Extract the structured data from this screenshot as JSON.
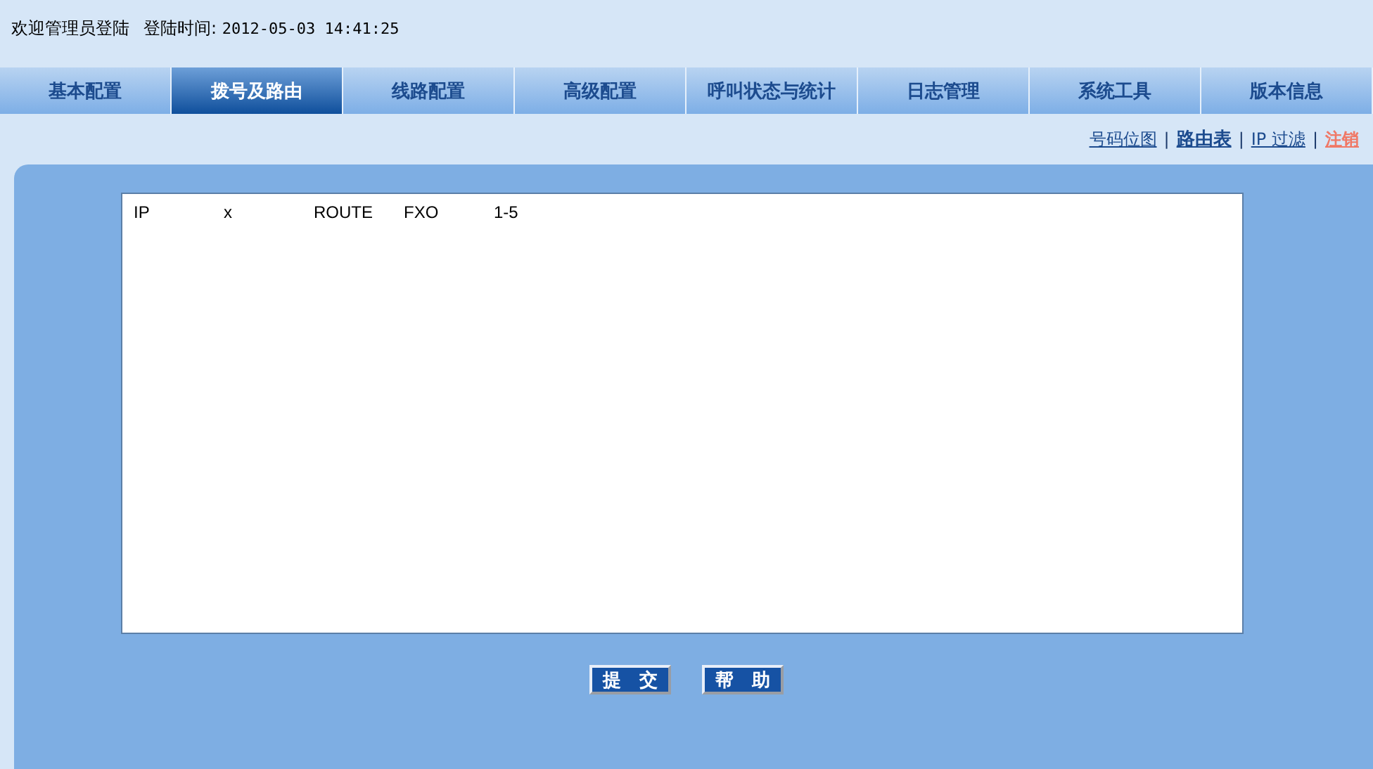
{
  "header": {
    "welcome": "欢迎管理员登陆",
    "login_time_label": "登陆时间:",
    "login_time": "2012-05-03 14:41:25"
  },
  "tabs": [
    {
      "label": "基本配置",
      "selected": false
    },
    {
      "label": "拨号及路由",
      "selected": true
    },
    {
      "label": "线路配置",
      "selected": false
    },
    {
      "label": "高级配置",
      "selected": false
    },
    {
      "label": "呼叫状态与统计",
      "selected": false
    },
    {
      "label": "日志管理",
      "selected": false
    },
    {
      "label": "系统工具",
      "selected": false
    },
    {
      "label": "版本信息",
      "selected": false
    }
  ],
  "sub_links": [
    {
      "label": "号码位图",
      "selected": false,
      "kind": "link"
    },
    {
      "label": "路由表",
      "selected": true,
      "kind": "link"
    },
    {
      "label": "IP 过滤",
      "selected": false,
      "kind": "link"
    },
    {
      "label": "注销",
      "selected": false,
      "kind": "logout"
    }
  ],
  "link_separators": [
    "|",
    "|",
    "|"
  ],
  "route_table": {
    "value": "IP\tx\tROUTE\tFXO\t1-5"
  },
  "buttons": [
    "提　交",
    "帮　助"
  ]
}
